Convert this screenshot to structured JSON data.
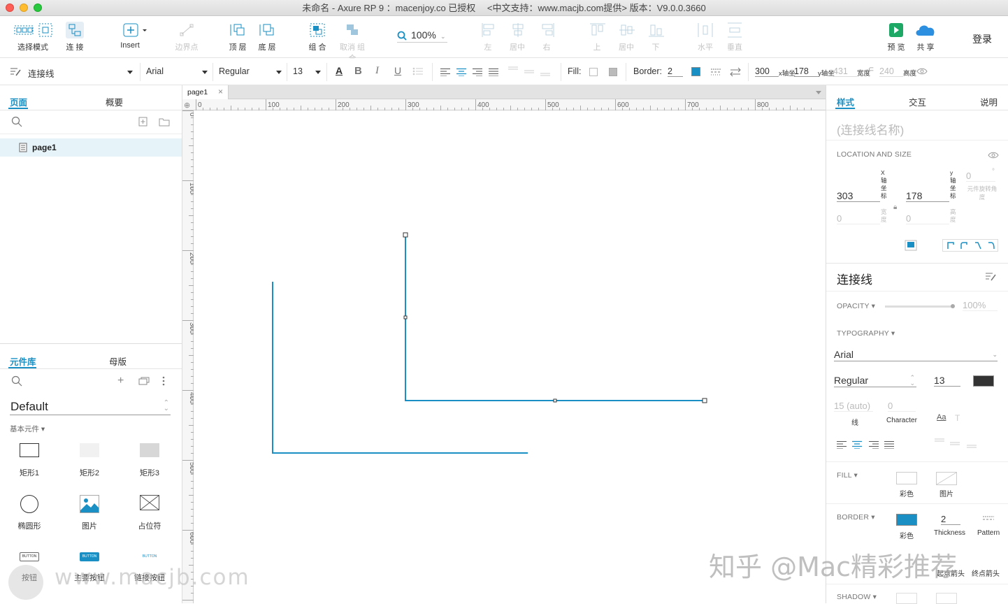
{
  "window": {
    "title": "未命名 - Axure RP 9 ：macenjoy.co 已授权　 <中文支持：www.macjb.com提供> 版本：V9.0.0.3660"
  },
  "toolbar": {
    "select_mode": "选择模式",
    "connect": "连 接",
    "insert": "Insert",
    "edge_points": "边界点",
    "top_layer": "顶 层",
    "bottom_layer": "底 层",
    "group": "组 合",
    "ungroup": "取消 组合",
    "zoom": "100%",
    "align_left": "左",
    "align_center": "居中",
    "align_right": "右",
    "align_top": "上",
    "align_middle": "居中",
    "align_bottom": "下",
    "dist_h": "水平",
    "dist_v": "垂直",
    "preview": "预 览",
    "share": "共 享",
    "login": "登录"
  },
  "stylebar": {
    "style_name": "连接线",
    "font": "Arial",
    "weight": "Regular",
    "size": "13",
    "fill_label": "Fill:",
    "border_label": "Border:",
    "border_value": "2",
    "x": "300",
    "x_label": "x轴坐",
    "y": "178",
    "y_label": "y轴坐",
    "w": "431",
    "w_label": "宽度",
    "h": "240",
    "h_label": "高度",
    "border_color": "#1a8fc4"
  },
  "left": {
    "tab_pages": "页面",
    "tab_outline": "概要",
    "page_item": "page1",
    "tab_library": "元件库",
    "tab_masters": "母版",
    "library_name": "Default",
    "category": "基本元件 ▾",
    "widgets": [
      "矩形1",
      "矩形2",
      "矩形3",
      "椭圆形",
      "图片",
      "占位符",
      "按钮",
      "主要按钮",
      "链接按钮"
    ],
    "button_text": "BUTTON"
  },
  "canvas": {
    "tab": "page1",
    "ruler_h": [
      "0",
      "100",
      "200",
      "300",
      "400",
      "500",
      "600",
      "700",
      "800"
    ],
    "ruler_v": [
      "0",
      "100",
      "200",
      "300",
      "400",
      "500",
      "600"
    ],
    "line_color": "#1a8fc4"
  },
  "right": {
    "tab_style": "样式",
    "tab_interaction": "交互",
    "tab_notes": "说明",
    "name_placeholder": "(连接线名称)",
    "loc_size": "LOCATION AND SIZE",
    "x": "303",
    "x_label": "X 轴 坐 标",
    "y": "178",
    "y_label": "y 轴 坐 标",
    "rotation": "0",
    "rotation_unit": "°",
    "rotation_label": "元件旋转角度",
    "width": "0",
    "width_label": "宽度",
    "height": "0",
    "height_label": "高度",
    "style_title": "连接线",
    "opacity_label": "OPACITY ▾",
    "opacity_value": "100%",
    "typography_label": "TYPOGRAPHY ▾",
    "font": "Arial",
    "weight": "Regular",
    "size": "13",
    "line_spacing": "15 (auto)",
    "line_label": "线",
    "char_spacing": "0",
    "char_label": "Character",
    "fill_label": "FILL ▾",
    "fill_color": "彩色",
    "fill_image": "图片",
    "border_label": "BORDER ▾",
    "border_color_label": "彩色",
    "thickness": "2",
    "thickness_label": "Thickness",
    "pattern_label": "Pattern",
    "arrow_label": "起点箭头",
    "end_arrow_label": "终点箭头",
    "shadow_label": "SHADOW ▾"
  },
  "watermarks": {
    "zhihu": "知乎 @Mac精彩推荐",
    "macjb": "www.macjb.com"
  }
}
